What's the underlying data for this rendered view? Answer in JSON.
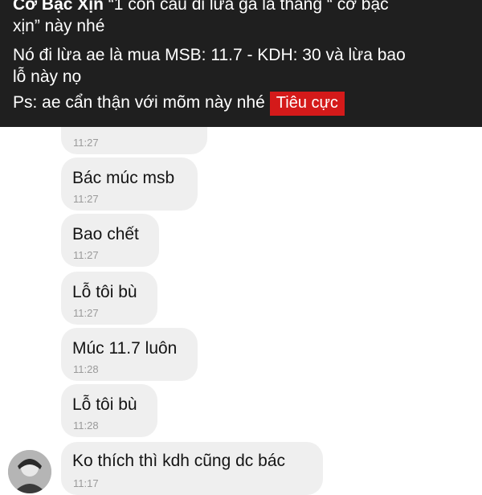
{
  "caption": {
    "author": "Cơ Bạc Xịn",
    "line1_rest": " “1 con cáu đi lừa gà là thằng “ cơ bạc",
    "line2": "xịn” này nhé",
    "line3": "Nó đi lừa ae là mua MSB: 11.7 - KDH: 30 và lừa bao",
    "line4": "lỗ này nọ",
    "line5": "Ps: ae cẩn thận với mõm này nhé",
    "tag": "Tiêu cực",
    "tag_color": "#d41a1a"
  },
  "messages": [
    {
      "text": "",
      "time": "11:27"
    },
    {
      "text": "Bác múc msb",
      "time": "11:27"
    },
    {
      "text": "Bao chết",
      "time": "11:27"
    },
    {
      "text": "Lỗ tôi bù",
      "time": "11:27"
    },
    {
      "text": "Múc 11.7 luôn",
      "time": "11:28"
    },
    {
      "text": "Lỗ tôi bù",
      "time": "11:28"
    },
    {
      "text": "Ko thích thì kdh cũng dc bác",
      "time": "11:17"
    }
  ]
}
